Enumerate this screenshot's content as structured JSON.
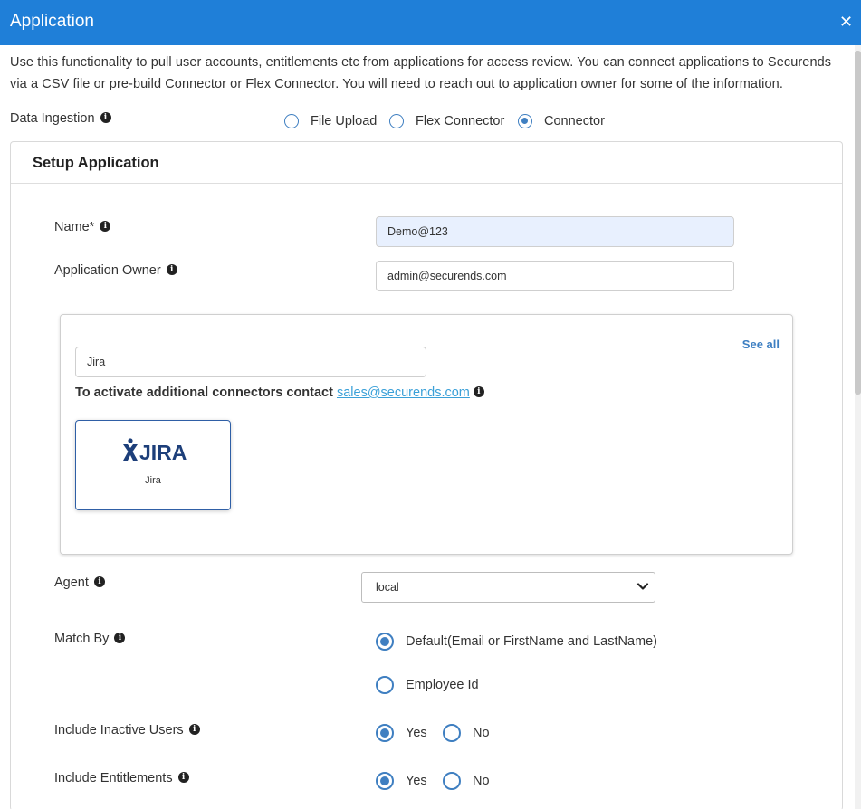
{
  "dialog": {
    "title": "Application",
    "close_icon": "close-icon"
  },
  "description": "Use this functionality to pull user accounts, entitlements etc from applications for access review. You can connect applications to Securends via a CSV file or pre-build Connector or Flex Connector. You will need to reach out to application owner for some of the information.",
  "data_ingestion": {
    "label": "Data Ingestion",
    "options": [
      {
        "label": "File Upload",
        "selected": false
      },
      {
        "label": "Flex Connector",
        "selected": false
      },
      {
        "label": "Connector",
        "selected": true
      }
    ]
  },
  "setup": {
    "title": "Setup Application",
    "name": {
      "label": "Name*",
      "value": "Demo@123"
    },
    "owner": {
      "label": "Application Owner",
      "value": "admin@securends.com"
    }
  },
  "connectors": {
    "search_value": "Jira",
    "see_all": "See all",
    "activate_text": "To activate additional connectors contact",
    "sales_email": "sales@securends.com",
    "tiles": [
      {
        "logo_text": "JIRA",
        "name": "Jira"
      }
    ]
  },
  "agent": {
    "label": "Agent",
    "value": "local"
  },
  "match_by": {
    "label": "Match By",
    "options": [
      {
        "label": "Default(Email or FirstName and LastName)",
        "selected": true
      },
      {
        "label": "Employee Id",
        "selected": false
      }
    ]
  },
  "include_inactive": {
    "label": "Include Inactive Users",
    "yes": "Yes",
    "no": "No",
    "value": "Yes"
  },
  "include_entitlements": {
    "label": "Include Entitlements",
    "yes": "Yes",
    "no": "No",
    "value": "Yes"
  },
  "colors": {
    "header": "#1f7fd8",
    "accent": "#3f7fc1",
    "link": "#3aa0d8"
  }
}
